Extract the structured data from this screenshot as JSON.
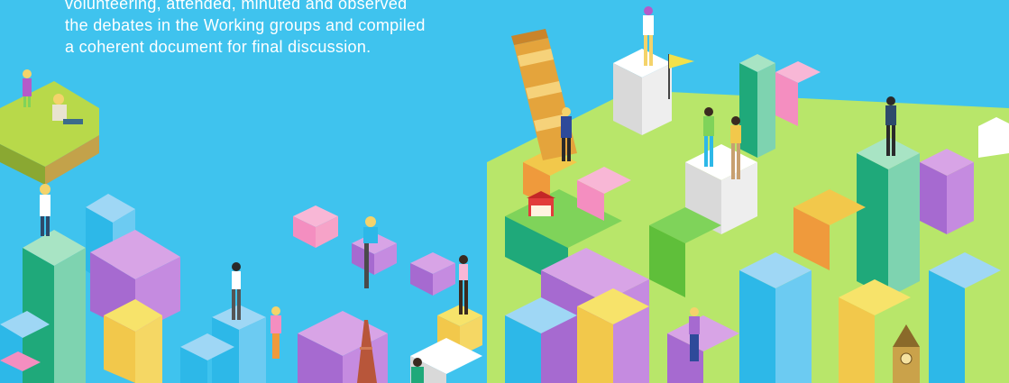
{
  "intro": {
    "line1": "volunteering, attended, minuted and observed",
    "line2": "the debates in the Working groups and compiled",
    "line3": "a coherent document for final discussion."
  },
  "colors": {
    "sky": "#3fc3ee",
    "text": "#ffffff",
    "block_palette": [
      "#7fd35a",
      "#b8e66a",
      "#f2c84b",
      "#ef9a3c",
      "#a66ad0",
      "#d8a4e6",
      "#2db8e8",
      "#9fd7f5",
      "#1fa97a",
      "#f48ec0",
      "#ffffff",
      "#c8c8c8"
    ]
  },
  "scene": {
    "description_icons": [
      "leaning-tower-icon",
      "eiffel-tower-icon",
      "big-ben-icon",
      "market-stall-icon",
      "flag-icon"
    ]
  }
}
